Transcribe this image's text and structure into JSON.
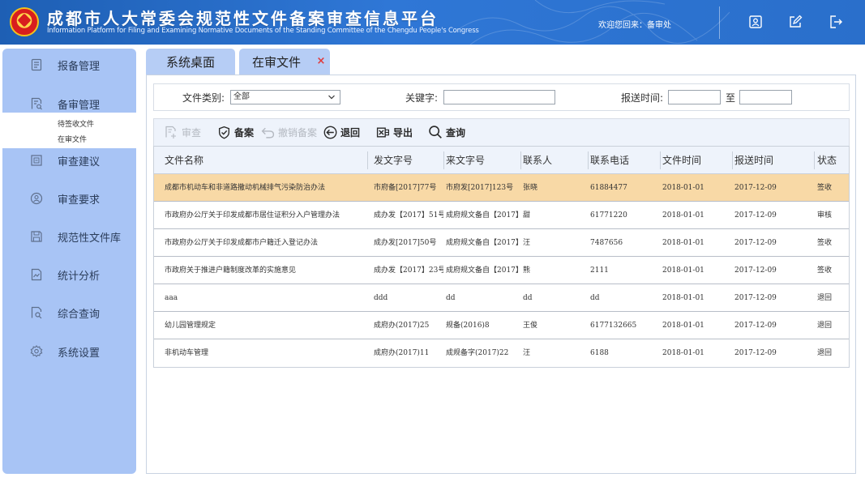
{
  "header": {
    "title_zh": "成都市人大常委会规范性文件备案审查信息平台",
    "title_en": "Information Platform for Filing and Examining Normative Documents of the Standing Committee of the Chengdu People's Congress",
    "welcome": "欢迎您回来：备审处",
    "icons": [
      "user-card-icon",
      "edit-icon",
      "logout-icon"
    ],
    "bg_color": "#2a6fcb"
  },
  "sidebar": {
    "bg_color": "#a8c4f5",
    "items": [
      {
        "label": "报备管理",
        "icon": "document-list-icon"
      },
      {
        "label": "备审管理",
        "icon": "review-document-icon",
        "children": [
          {
            "label": "待签收文件"
          },
          {
            "label": "在审文件"
          }
        ]
      },
      {
        "label": "审查建议",
        "icon": "suggestion-box-icon"
      },
      {
        "label": "审查要求",
        "icon": "user-circle-icon"
      },
      {
        "label": "规范性文件库",
        "icon": "save-disk-icon"
      },
      {
        "label": "统计分析",
        "icon": "chart-document-icon"
      },
      {
        "label": "综合查询",
        "icon": "search-document-icon"
      },
      {
        "label": "系统设置",
        "icon": "gear-icon"
      }
    ]
  },
  "tabs": [
    {
      "label": "系统桌面",
      "active": false
    },
    {
      "label": "在审文件",
      "active": true,
      "closable": true,
      "close_glyph": "×"
    }
  ],
  "filters": {
    "category_label": "文件类别:",
    "category_value": "全部",
    "keyword_label": "关键字:",
    "keyword_value": "",
    "time_label": "报送时间:",
    "time_to_label": "至",
    "time_from_value": "",
    "time_to_value": ""
  },
  "toolbar": {
    "buttons": [
      {
        "label": "审查",
        "icon": "review-icon",
        "enabled": false
      },
      {
        "label": "备案",
        "icon": "shield-check-icon",
        "enabled": true
      },
      {
        "label": "撤销备案",
        "icon": "undo-icon",
        "enabled": false
      },
      {
        "label": "退回",
        "icon": "back-arrow-icon",
        "enabled": true
      },
      {
        "label": "导出",
        "icon": "excel-export-icon",
        "enabled": true
      },
      {
        "label": "查询",
        "icon": "search-icon",
        "enabled": true
      }
    ]
  },
  "table": {
    "columns": [
      "文件名称",
      "发文字号",
      "来文字号",
      "联系人",
      "联系电话",
      "文件时间",
      "报送时间",
      "状态"
    ],
    "selected_row": 0,
    "selected_color": "#f8d9a6",
    "rows": [
      [
        "成都市机动车和非道路撒动机械排气污染防治办法",
        "市府备[2017]77号",
        "市府发[2017]123号",
        "张晓",
        "61884477",
        "2018-01-01",
        "2017-12-09",
        "签收"
      ],
      [
        "市政府办公厅关于印发成都市居住证积分入户管理办法",
        "成办发【2017】51号",
        "成府规文备自【2017】第",
        "甜",
        "61771220",
        "2018-01-01",
        "2017-12-09",
        "审核"
      ],
      [
        "市政府办公厅关于印发成都市户籍迁入登记办法",
        "成办发[2017]50号",
        "成府规文备自【2017】第",
        "汪",
        "7487656",
        "2018-01-01",
        "2017-12-09",
        "签收"
      ],
      [
        "市政府关于推进户籍制度改革的实施意见",
        "成办发【2017】23号",
        "成府规文备自【2017】第",
        "熊",
        "2111",
        "2018-01-01",
        "2017-12-09",
        "签收"
      ],
      [
        "aaa",
        "ddd",
        "dd",
        "dd",
        "dd",
        "2018-01-01",
        "2017-12-09",
        "退回"
      ],
      [
        "幼儿园管理规定",
        "成府办(2017)25",
        "规备(2016)8",
        "王俊",
        "6177132665",
        "2018-01-01",
        "2017-12-09",
        "退回"
      ],
      [
        "非机动车管理",
        "成府办(2017)11",
        "成规备字(2017)22",
        "汪",
        "6188",
        "2018-01-01",
        "2017-12-09",
        "退回"
      ]
    ]
  }
}
